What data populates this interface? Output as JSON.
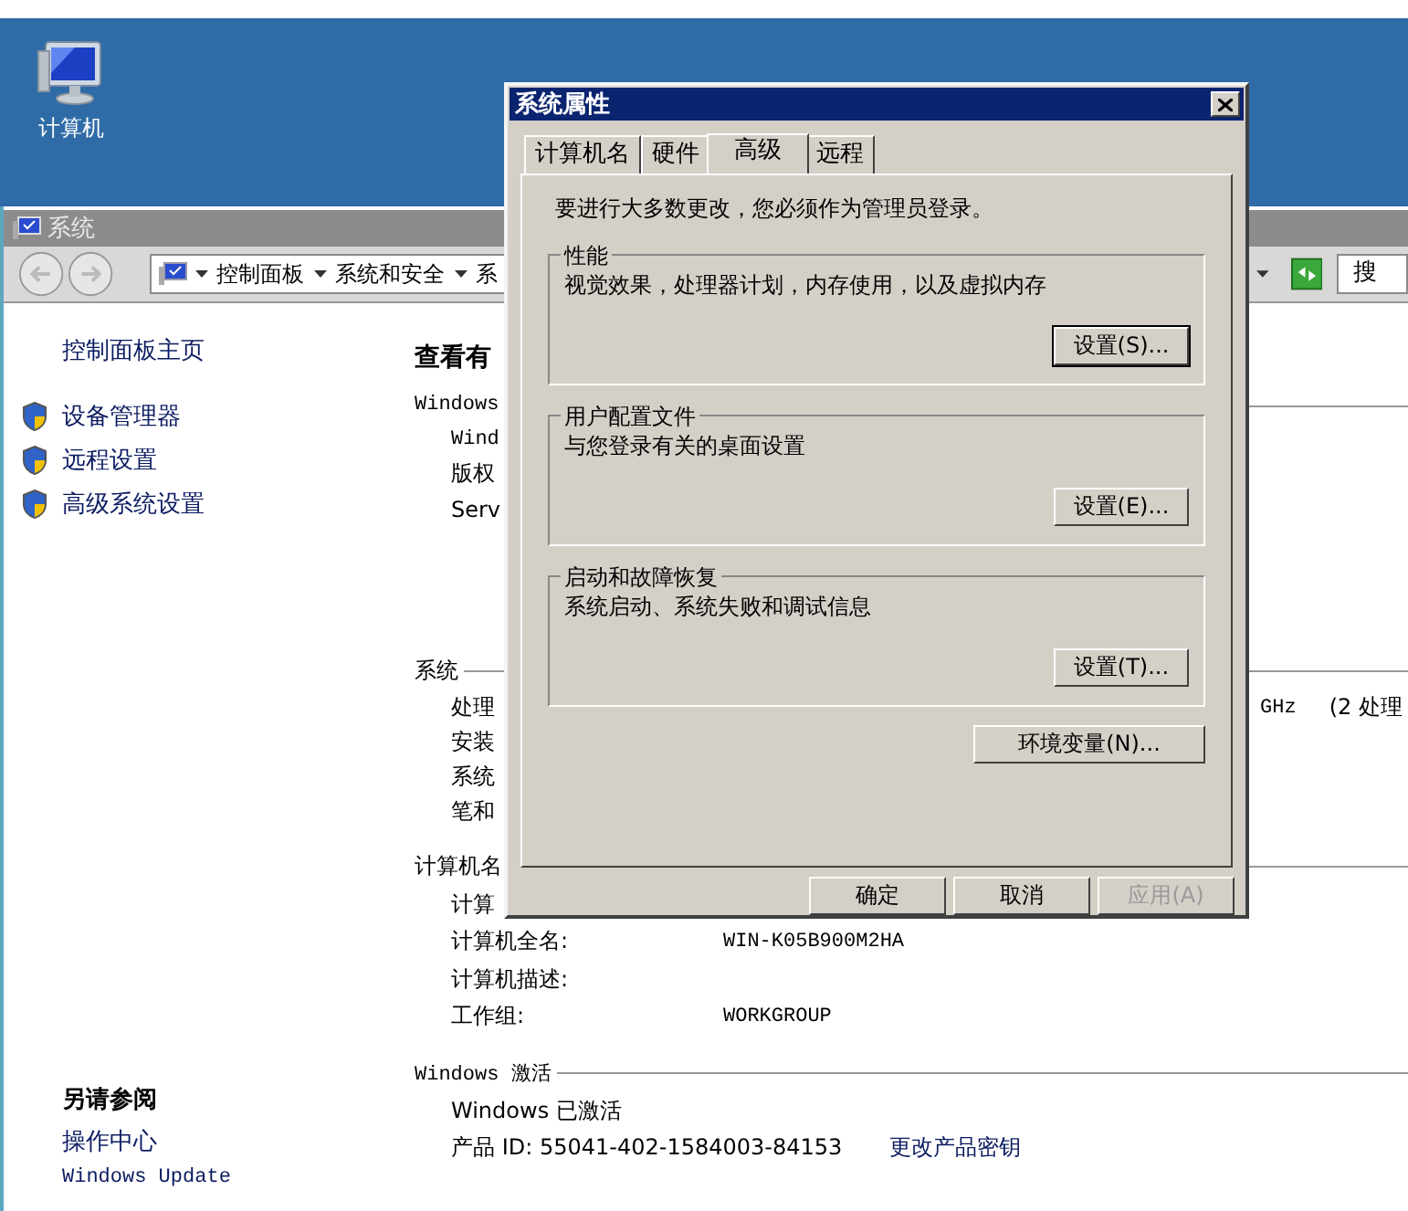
{
  "desktop_icons": [
    {
      "label": "计算机"
    }
  ],
  "system_window": {
    "title": "系统",
    "breadcrumb": [
      "控制面板",
      "系统和安全",
      "系"
    ],
    "search": {
      "placeholder": "搜"
    },
    "sidebar": {
      "home": "控制面板主页",
      "tasks": [
        "设备管理器",
        "远程设置",
        "高级系统设置"
      ],
      "see_also": {
        "heading": "另请参阅",
        "links": [
          "操作中心",
          "Windows Update"
        ]
      }
    },
    "main": {
      "heading": "查看有",
      "sections": [
        {
          "title": "Windows",
          "rows": [
            {
              "label": "Wind"
            },
            {
              "label": "版权"
            },
            {
              "label": "Serv"
            }
          ]
        },
        {
          "title": "系统",
          "rows": [
            {
              "label": "处理",
              "extra": [
                "GHz",
                "(2 处理"
              ]
            },
            {
              "label": "安装"
            },
            {
              "label": "系统"
            },
            {
              "label": "笔和"
            }
          ]
        },
        {
          "title": "计算机名",
          "rows": [
            {
              "label": "计算"
            },
            {
              "label": "计算机全名:",
              "value": "WIN-K05B900M2HA"
            },
            {
              "label": "计算机描述:"
            },
            {
              "label": "工作组:",
              "value": "WORKGROUP"
            }
          ]
        },
        {
          "title": "Windows 激活",
          "rows": [
            {
              "label": "Windows 已激活"
            },
            {
              "label": "产品 ID: 55041-402-1584003-84153",
              "link": "更改产品密钥"
            }
          ]
        }
      ]
    }
  },
  "dialog": {
    "title": "系统属性",
    "tabs": [
      {
        "label": "计算机名",
        "selected": false
      },
      {
        "label": "硬件",
        "selected": false
      },
      {
        "label": "高级",
        "selected": true
      },
      {
        "label": "远程",
        "selected": false
      }
    ],
    "note": "要进行大多数更改，您必须作为管理员登录。",
    "groups": [
      {
        "title": "性能",
        "description": "视觉效果，处理器计划，内存使用，以及虚拟内存",
        "button": {
          "label": "设置(S)...",
          "default": true
        }
      },
      {
        "title": "用户配置文件",
        "description": "与您登录有关的桌面设置",
        "button": {
          "label": "设置(E)...",
          "default": false
        }
      },
      {
        "title": "启动和故障恢复",
        "description": "系统启动、系统失败和调试信息",
        "button": {
          "label": "设置(T)...",
          "default": false
        }
      }
    ],
    "env_button": "环境变量(N)...",
    "buttons": [
      {
        "label": "确定",
        "disabled": false
      },
      {
        "label": "取消",
        "disabled": false
      },
      {
        "label": "应用(A)",
        "disabled": true
      }
    ]
  }
}
